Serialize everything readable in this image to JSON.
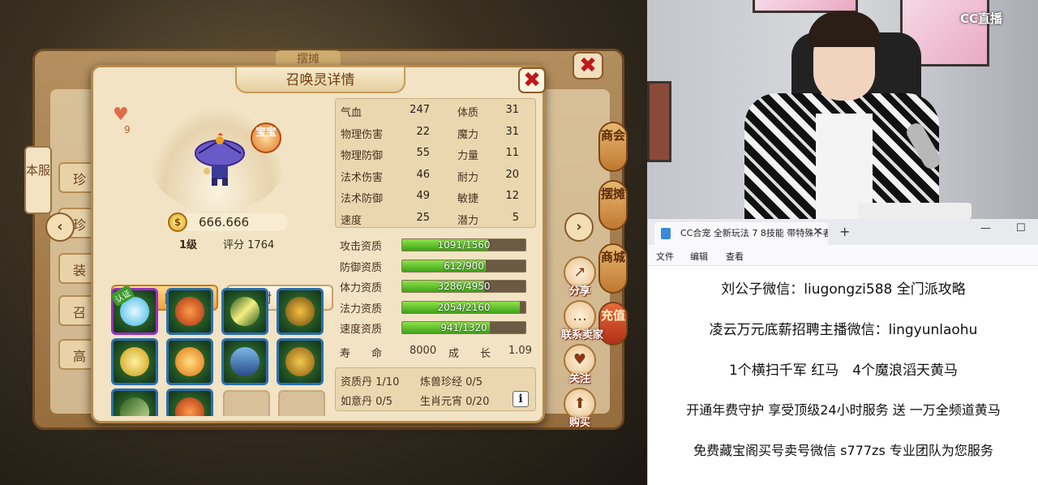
{
  "game": {
    "bg_title": "摆摊",
    "left_tab": "本服",
    "bg_rows": [
      "珍",
      "珍",
      "装",
      "召",
      "高"
    ],
    "side_tabs": [
      "商会",
      "摆摊",
      "商城",
      "充值"
    ],
    "side_actions": [
      {
        "label": "分享",
        "icon": "share-icon"
      },
      {
        "label": "联系卖家",
        "icon": "chat-icon"
      },
      {
        "label": "关注",
        "icon": "heart-icon"
      },
      {
        "label": "购买",
        "icon": "buy-icon"
      }
    ],
    "nav_left": "‹",
    "nav_right": "›"
  },
  "dialog": {
    "title": "召唤灵详情",
    "close": "✖",
    "favorites": "9",
    "bao_badge": "宝宝",
    "price": "666.666",
    "coin_symbol": "$",
    "level": "1级",
    "score_label": "评分",
    "score_value": "1764",
    "tab_skill": "技能",
    "tab_add": "附加",
    "stats": [
      {
        "label": "气血",
        "value": "247"
      },
      {
        "label": "体质",
        "value": "31"
      },
      {
        "label": "物理伤害",
        "value": "22"
      },
      {
        "label": "魔力",
        "value": "31"
      },
      {
        "label": "物理防御",
        "value": "55"
      },
      {
        "label": "力量",
        "value": "11"
      },
      {
        "label": "法术伤害",
        "value": "46"
      },
      {
        "label": "耐力",
        "value": "20"
      },
      {
        "label": "法术防御",
        "value": "49"
      },
      {
        "label": "敏捷",
        "value": "12"
      },
      {
        "label": "速度",
        "value": "25"
      },
      {
        "label": "潜力",
        "value": "5"
      }
    ],
    "aptitudes": [
      {
        "label": "攻击资质",
        "text": "1091/1560",
        "fraction": 0.699
      },
      {
        "label": "防御资质",
        "text": "612/900",
        "fraction": 0.68
      },
      {
        "label": "体力资质",
        "text": "3286/4950",
        "fraction": 0.664
      },
      {
        "label": "法力资质",
        "text": "2054/2160",
        "fraction": 0.951
      },
      {
        "label": "速度资质",
        "text": "941/1320",
        "fraction": 0.713
      }
    ],
    "life_label": "寿　　命",
    "life_value": "8000",
    "growth_label": "成　　长",
    "growth_value": "1.09",
    "extras": [
      {
        "label": "资质丹",
        "value": "1/10"
      },
      {
        "label": "炼兽珍经",
        "value": "0/5"
      },
      {
        "label": "如意丹",
        "value": "0/5"
      },
      {
        "label": "生肖元宵",
        "value": "0/20"
      }
    ],
    "info_icon": "i",
    "skill_tag": "认证"
  },
  "stream": {
    "logo": "CC直播"
  },
  "notepad": {
    "tab_title": "CC合宠 全新玩法 7 8技能 带特殊不者",
    "tab_close": "×",
    "new_tab": "+",
    "min": "—",
    "max": "☐",
    "menu": [
      "文件",
      "编辑",
      "查看"
    ],
    "lines": [
      "刘公子微信：liugongzi588 全门派攻略",
      "凌云万元底薪招聘主播微信：lingyunlaohu",
      "1个横扫千军 红马　4个魔浪滔天黄马",
      "开通年费守护 享受顶级24小时服务 送 一万全频道黄马",
      "免费藏宝阁买号卖号微信 s777zs 专业团队为您服务"
    ]
  },
  "colors": {
    "accent": "#f0a43a",
    "bar_fill": "#3ea318",
    "close_red": "#c01818"
  }
}
